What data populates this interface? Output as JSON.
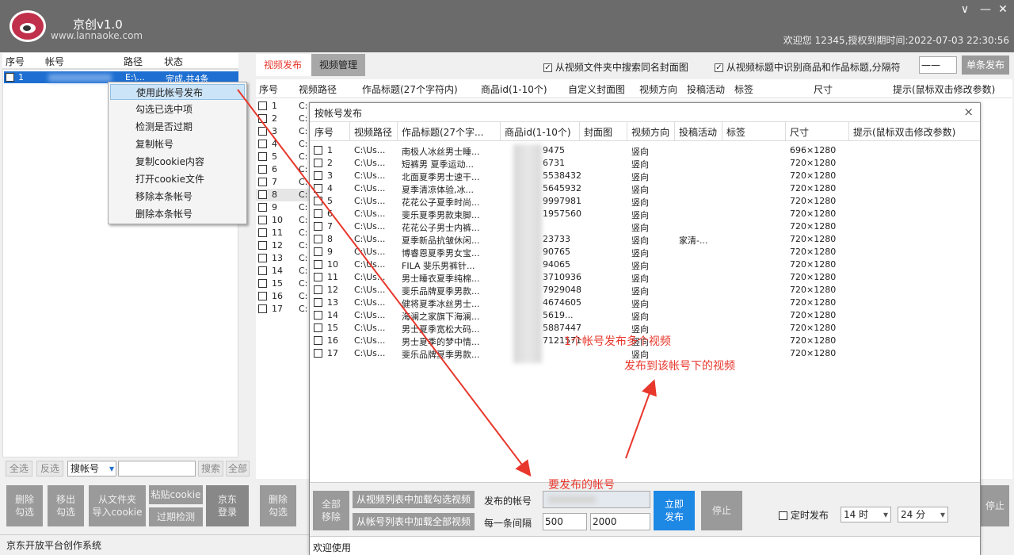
{
  "app": {
    "title": "京创v1.0",
    "url": "www.lannaoke.com",
    "welcome": "欢迎您 12345,授权到期时间:2022-07-03 22:30:56"
  },
  "window_controls": {
    "minimize": "∨",
    "min2": "—",
    "close": "✕"
  },
  "accounts": {
    "headers": [
      "序号",
      "帐号",
      "路径",
      "状态"
    ],
    "row": {
      "num": "1",
      "path": "E:\\...",
      "status": "完成,共4条"
    }
  },
  "context_menu": [
    "使用此帐号发布",
    "勾选已选中项",
    "检测是否过期",
    "复制帐号",
    "复制cookie内容",
    "打开cookie文件",
    "移除本条帐号",
    "删除本条帐号"
  ],
  "left_toolbar": {
    "select_all": "全选",
    "invert": "反选",
    "search_type": "搜帐号",
    "search": "搜索",
    "all": "全部"
  },
  "left_buttons": {
    "delete_checked": "删除\n勾选",
    "move_checked": "移出\n勾选",
    "import_cookie": "从文件夹\n导入cookie",
    "paste_cookie": "粘贴cookie",
    "expire_check": "过期检测",
    "jd_login": "京东\n登录"
  },
  "left_status": "京东开放平台创作系统",
  "tabs": [
    "视频发布",
    "视频管理"
  ],
  "options": {
    "search_cover": "从视频文件夹中搜索同名封面图",
    "parse_title": "从视频标题中识别商品和作品标题,分隔符",
    "separator": "——",
    "single_publish": "单条发布"
  },
  "right_headers": [
    "序号",
    "视频路径",
    "作品标题(27个字符内)",
    "商品id(1-10个)",
    "自定义封面图",
    "视频方向",
    "投稿活动",
    "标签",
    "尺寸",
    "提示(鼠标双击修改参数)"
  ],
  "right_rows": [
    "1",
    "2",
    "3",
    "4",
    "5",
    "6",
    "7",
    "8",
    "9",
    "10",
    "11",
    "12",
    "13",
    "14",
    "15",
    "16",
    "17"
  ],
  "right_path_prefix": "C:",
  "right_bottom": {
    "delete_checked": "删除\n勾选",
    "stop": "停止"
  },
  "dialog": {
    "title": "按帐号发布",
    "close": "×",
    "headers": [
      "序号",
      "视频路径",
      "作品标题(27个字...",
      "商品id(1-10个)",
      "封面图",
      "视频方向",
      "投稿活动",
      "标签",
      "尺寸",
      "提示(鼠标双击修改参数)"
    ],
    "rows": [
      {
        "n": "1",
        "path": "C:\\Us...",
        "title": "南极人冰丝男士睡...",
        "id": "9475",
        "dir": "竖向",
        "act": "",
        "size": "696×1280"
      },
      {
        "n": "2",
        "path": "C:\\Us...",
        "title": "短裤男 夏季运动...",
        "id": "6731",
        "dir": "竖向",
        "act": "",
        "size": "720×1280"
      },
      {
        "n": "3",
        "path": "C:\\Us...",
        "title": "北面夏季男士速干...",
        "id": "5538432",
        "dir": "竖向",
        "act": "",
        "size": "720×1280"
      },
      {
        "n": "4",
        "path": "C:\\Us...",
        "title": "夏季清凉体验,冰...",
        "id": "5645932",
        "dir": "竖向",
        "act": "",
        "size": "720×1280"
      },
      {
        "n": "5",
        "path": "C:\\Us...",
        "title": "花花公子夏季时尚...",
        "id": "9997981",
        "dir": "竖向",
        "act": "",
        "size": "720×1280"
      },
      {
        "n": "6",
        "path": "C:\\Us...",
        "title": "斐乐夏季男款束脚...",
        "id": "1957560",
        "dir": "竖向",
        "act": "",
        "size": "720×1280"
      },
      {
        "n": "7",
        "path": "C:\\Us...",
        "title": "花花公子男士内裤...",
        "id": "",
        "dir": "竖向",
        "act": "",
        "size": "720×1280"
      },
      {
        "n": "8",
        "path": "C:\\Us...",
        "title": "夏季新品抗皱休闲...",
        "id": "23733",
        "dir": "竖向",
        "act": "家清-...",
        "size": "720×1280"
      },
      {
        "n": "9",
        "path": "C:\\Us...",
        "title": "博睿恩夏季男女宝...",
        "id": "90765",
        "dir": "竖向",
        "act": "",
        "size": "720×1280"
      },
      {
        "n": "10",
        "path": "C:\\Us...",
        "title": "FILA 斐乐男裤针...",
        "id": "94065",
        "dir": "竖向",
        "act": "",
        "size": "720×1280"
      },
      {
        "n": "11",
        "path": "C:\\Us...",
        "title": "男士睡衣夏季纯棉...",
        "id": "3710936",
        "dir": "竖向",
        "act": "",
        "size": "720×1280"
      },
      {
        "n": "12",
        "path": "C:\\Us...",
        "title": "斐乐品牌夏季男款...",
        "id": "7929048",
        "dir": "竖向",
        "act": "",
        "size": "720×1280"
      },
      {
        "n": "13",
        "path": "C:\\Us...",
        "title": "健将夏季冰丝男士...",
        "id": "4674605",
        "dir": "竖向",
        "act": "",
        "size": "720×1280"
      },
      {
        "n": "14",
        "path": "C:\\Us...",
        "title": "海澜之家旗下海澜...",
        "id": "5619...",
        "dir": "竖向",
        "act": "",
        "size": "720×1280"
      },
      {
        "n": "15",
        "path": "C:\\Us...",
        "title": "男士夏季宽松大码...",
        "id": "5887447",
        "dir": "竖向",
        "act": "",
        "size": "720×1280"
      },
      {
        "n": "16",
        "path": "C:\\Us...",
        "title": "男士夏季的梦中情...",
        "id": "7121571",
        "dir": "竖向",
        "act": "",
        "size": "720×1280"
      },
      {
        "n": "17",
        "path": "C:\\Us...",
        "title": "斐乐品牌夏季男款...",
        "id": "",
        "dir": "竖向",
        "act": "",
        "size": "720×1280"
      }
    ],
    "bottom": {
      "remove_all": "全部\n移除",
      "load_checked": "从视频列表中加载勾选视频",
      "load_all": "从帐号列表中加载全部视频",
      "account_label": "发布的帐号",
      "interval_label": "每一条间隔",
      "interval_min": "500",
      "interval_max": "2000",
      "publish_now": "立即\n发布",
      "stop": "停止",
      "scheduled": "定时发布",
      "hour": "14 时",
      "minute": "24 分"
    },
    "status": "欢迎使用"
  },
  "annotations": {
    "one_account": "1个帐号发布多个视频",
    "videos_under": "发布到该帐号下的视频",
    "target_account": "要发布的帐号"
  },
  "colors": {
    "accent": "#e8372c",
    "blue": "#1e88e5",
    "selected": "#1e6fd1"
  }
}
